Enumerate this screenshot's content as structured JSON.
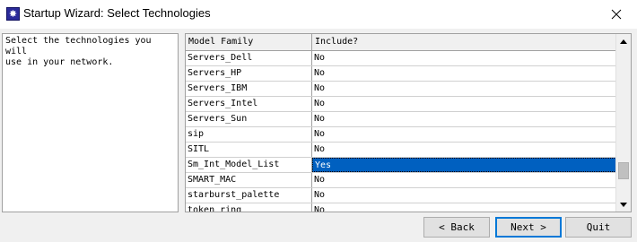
{
  "window": {
    "title": "Startup Wizard: Select Technologies",
    "icon": "sparkle-icon",
    "close_icon": "close-icon"
  },
  "instructions": "Select the technologies you will\nuse in your network.",
  "table": {
    "columns": [
      "Model Family",
      "Include?"
    ],
    "rows": [
      {
        "family": "Servers_Dell",
        "include": "No"
      },
      {
        "family": "Servers_HP",
        "include": "No"
      },
      {
        "family": "Servers_IBM",
        "include": "No"
      },
      {
        "family": "Servers_Intel",
        "include": "No"
      },
      {
        "family": "Servers_Sun",
        "include": "No"
      },
      {
        "family": "sip",
        "include": "No"
      },
      {
        "family": "SITL",
        "include": "No"
      },
      {
        "family": "Sm_Int_Model_List",
        "include": "Yes",
        "selected": true
      },
      {
        "family": "SMART_MAC",
        "include": "No"
      },
      {
        "family": "starburst_palette",
        "include": "No"
      },
      {
        "family": "token_ring",
        "include": "No"
      }
    ],
    "selection_color": "#0060c0"
  },
  "buttons": {
    "back": "< Back",
    "next": "Next >",
    "quit": "Quit"
  }
}
